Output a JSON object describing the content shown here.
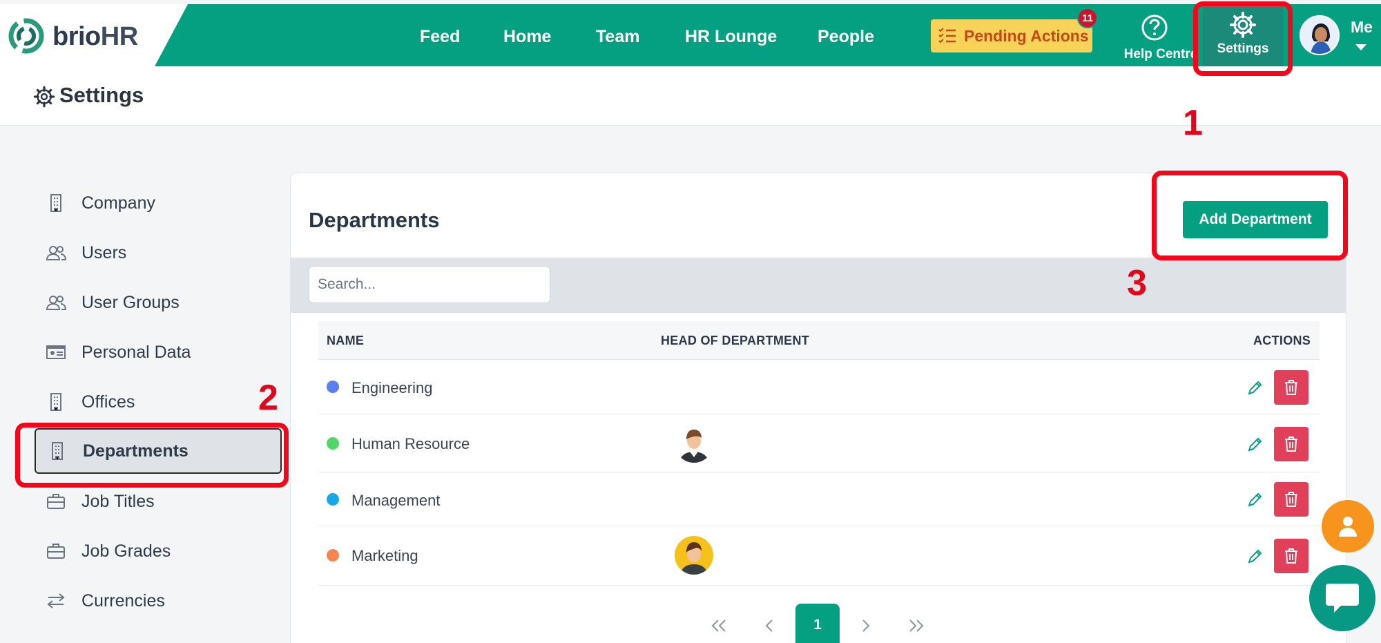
{
  "brand": {
    "name_left": "brio",
    "name_right": "HR"
  },
  "nav": {
    "links": [
      "Feed",
      "Home",
      "Team",
      "HR Lounge",
      "People"
    ],
    "pending_label": "Pending Actions",
    "pending_count": "11",
    "help_label": "Help Centre",
    "settings_label": "Settings",
    "me_label": "Me"
  },
  "page": {
    "title": "Settings"
  },
  "sidebar": {
    "items": [
      {
        "label": "Company",
        "icon": "building-icon"
      },
      {
        "label": "Users",
        "icon": "users-icon"
      },
      {
        "label": "User Groups",
        "icon": "users-icon"
      },
      {
        "label": "Personal Data",
        "icon": "id-card-icon"
      },
      {
        "label": "Offices",
        "icon": "building-icon"
      },
      {
        "label": "Departments",
        "icon": "building-icon",
        "active": true
      },
      {
        "label": "Job Titles",
        "icon": "briefcase-icon"
      },
      {
        "label": "Job Grades",
        "icon": "briefcase-icon"
      },
      {
        "label": "Currencies",
        "icon": "arrows-icon"
      }
    ]
  },
  "departments": {
    "title": "Departments",
    "add_label": "Add Department",
    "search_placeholder": "Search...",
    "columns": {
      "name": "NAME",
      "head": "HEAD OF DEPARTMENT",
      "actions": "ACTIONS"
    },
    "rows": [
      {
        "name": "Engineering",
        "color": "#5b7ff0",
        "head": ""
      },
      {
        "name": "Human Resource",
        "color": "#52d669",
        "head": "avatar-man"
      },
      {
        "name": "Management",
        "color": "#19a8e6",
        "head": ""
      },
      {
        "name": "Marketing",
        "color": "#f5874e",
        "head": "avatar-man-yellow"
      }
    ],
    "pagination": {
      "current": "1"
    }
  },
  "annotations": [
    "1",
    "2",
    "3"
  ],
  "colors": {
    "brand": "#05a081",
    "danger": "#e0405a",
    "highlight": "#f2071b",
    "pending_bg": "#f7d35a"
  }
}
